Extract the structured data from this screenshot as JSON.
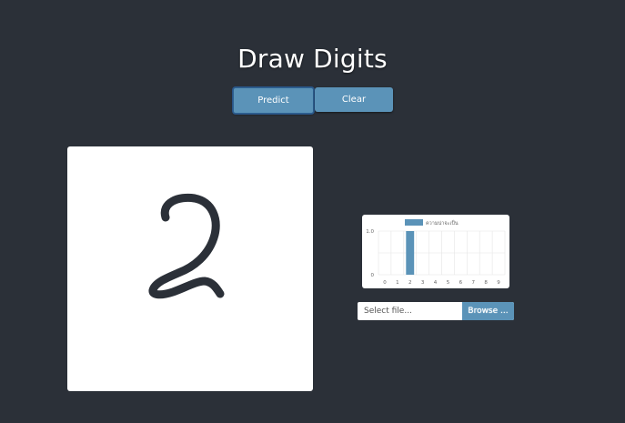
{
  "header": {
    "title": "Draw Digits"
  },
  "toolbar": {
    "predict_label": "Predict",
    "clear_label": "Clear"
  },
  "file": {
    "placeholder": "Select file...",
    "browse_label": "Browse ..."
  },
  "colors": {
    "background": "#2b3038",
    "button": "#5b93b8",
    "bar": "#5b93b8",
    "ink": "#2b3038"
  },
  "chart_data": {
    "type": "bar",
    "legend_position": "top",
    "grid": true,
    "categories": [
      "0",
      "1",
      "2",
      "3",
      "4",
      "5",
      "6",
      "7",
      "8",
      "9"
    ],
    "series": [
      {
        "name": "ความน่าจะเป็น",
        "values": [
          0,
          0,
          1.0,
          0,
          0,
          0,
          0,
          0,
          0,
          0
        ]
      }
    ],
    "yticks": [
      "0",
      "0.5",
      "1.0"
    ],
    "ylim": [
      0,
      1.0
    ]
  }
}
